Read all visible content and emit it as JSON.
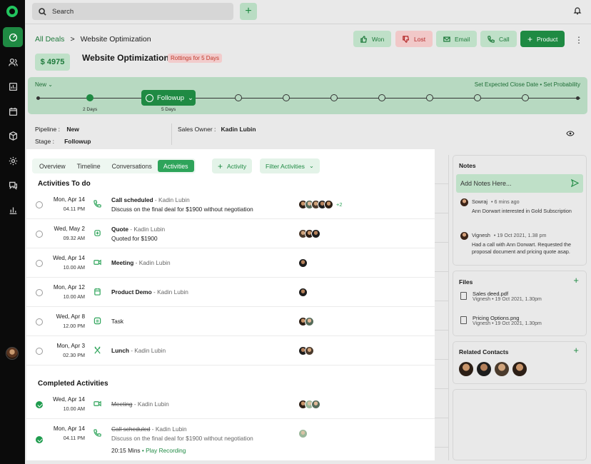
{
  "colors": {
    "accent": "#1f8a43",
    "accent_light": "#bfe0c8",
    "danger": "#c0392b",
    "sidebar": "#0b0b0b"
  },
  "topbar": {
    "search_label": "Search",
    "plus_icon": "plus-icon",
    "bell_icon": "bell-icon"
  },
  "breadcrumb": {
    "root": "All Deals",
    "separator": ">",
    "current": "Website Optimization"
  },
  "actions": {
    "won": "Won",
    "lost": "Lost",
    "email": "Email",
    "call": "Call",
    "product": "Product"
  },
  "deal": {
    "amount": "$ 4975",
    "title": "Website Optimization",
    "rotting": "Rottings for 5 Days"
  },
  "stages": {
    "first": "New",
    "current": "Followup",
    "links": "Set Expected Close Date • Set Probability",
    "days_a": "2 Days",
    "days_b": "5 Days"
  },
  "info": {
    "pipeline_label": "Pipeline :",
    "pipeline_value": "New",
    "stage_label": "Stage :",
    "stage_value": "Followup",
    "owner_label": "Sales Owner :",
    "owner_value": "Kadin Lubin"
  },
  "tabs": [
    "Overview",
    "Timeline",
    "Conversations",
    "Activities"
  ],
  "active_tab": "Activities",
  "add_activity": "Activity",
  "filter_activities": "Filter Activities",
  "todo_title": "Activities To do",
  "todo": [
    {
      "date": "Mon, Apr 14",
      "time": "04.11 PM",
      "type": "phone-icon",
      "title": "Call scheduled",
      "sep": " - ",
      "who": "Kadin Lubin",
      "note": "Discuss on the final deal for $1900 without negotiation",
      "more": "+2"
    },
    {
      "date": "Wed, May 2",
      "time": "09.32 AM",
      "type": "quote-icon",
      "title": "Quote",
      "sep": " - ",
      "who": "Kadin Lubin",
      "note": "Quoted for $1900",
      "more": ""
    },
    {
      "date": "Wed, Apr 14",
      "time": "10.00 AM",
      "type": "video-icon",
      "title": "Meeting",
      "sep": " - ",
      "who": "Kadin Lubin",
      "note": "",
      "more": ""
    },
    {
      "date": "Mon, Apr 12",
      "time": "10.00 AM",
      "type": "calendar-icon",
      "title": "Product Demo",
      "sep": " - ",
      "who": "Kadin Lubin",
      "note": "",
      "more": ""
    },
    {
      "date": "Wed, Apr 8",
      "time": "12.00 PM",
      "type": "task-icon",
      "title": "Task",
      "sep": "",
      "who": "",
      "note": "",
      "more": ""
    },
    {
      "date": "Mon, Apr 3",
      "time": "02.30 PM",
      "type": "fork-knife-icon",
      "title": "Lunch",
      "sep": " - ",
      "who": "Kadin Lubin",
      "note": "",
      "more": ""
    }
  ],
  "completed_title": "Completed Activities",
  "completed": [
    {
      "date": "Wed, Apr 14",
      "time": "10.00 AM",
      "type": "video-icon",
      "title": "Meeting",
      "sep": " - ",
      "who": "Kadin Lubin",
      "note": "",
      "duration": "",
      "play": ""
    },
    {
      "date": "Mon, Apr 14",
      "time": "04.11 PM",
      "type": "phone-icon",
      "title": "Call scheduled",
      "sep": " - ",
      "who": "Kadin Lubin",
      "note": "Discuss on the final deal for $1900 without negotiation",
      "duration": "20:15 Mins",
      "dot": "•",
      "play": "Play Recording"
    }
  ],
  "notes": {
    "title": "Notes",
    "placeholder": "Add Notes Here...",
    "items": [
      {
        "author": "Sowraj",
        "when": "• 6 mins ago",
        "text": "Ann Dorwart interested in Gold Subscription"
      },
      {
        "author": "Vignesh",
        "when": "• 19 Oct 2021, 1.38 pm",
        "text": "Had a call with Ann Dorwart. Requested the proposal document and pricing quote asap."
      }
    ]
  },
  "files": {
    "title": "Files",
    "items": [
      {
        "name": "Sales deed.pdf",
        "meta": "Vignesh • 19 Oct 2021, 1.30pm"
      },
      {
        "name": "Pricing Options.png",
        "meta": "Vignesh • 19 Oct 2021, 1.30pm"
      }
    ]
  },
  "related_contacts": {
    "title": "Related Contacts"
  }
}
